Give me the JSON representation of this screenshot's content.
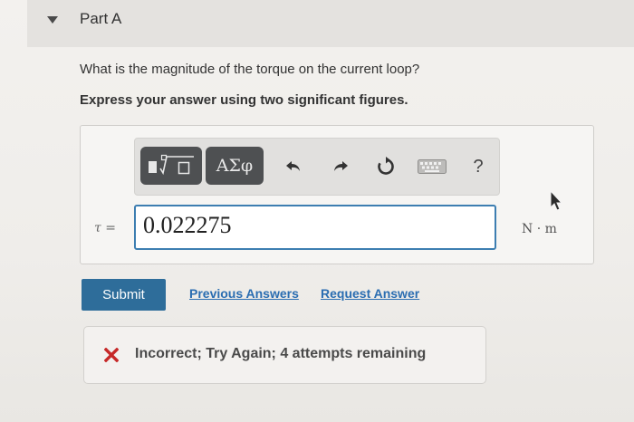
{
  "part": {
    "title": "Part A"
  },
  "question": {
    "text": "What is the magnitude of the torque on the current loop?",
    "instruction": "Express your answer using two significant figures."
  },
  "toolbar": {
    "symbols_label": "ΑΣφ",
    "help_label": "?"
  },
  "answer": {
    "variable_label": "τ =",
    "value": "0.022275",
    "unit": "N · m"
  },
  "actions": {
    "submit_label": "Submit",
    "previous_answers_label": "Previous Answers",
    "request_answer_label": "Request Answer"
  },
  "feedback": {
    "message": "Incorrect; Try Again; 4 attempts remaining"
  },
  "colors": {
    "submit": "#2e6d9a",
    "link": "#2a6db1",
    "input_border": "#3d7eb1",
    "error": "#c62828"
  }
}
